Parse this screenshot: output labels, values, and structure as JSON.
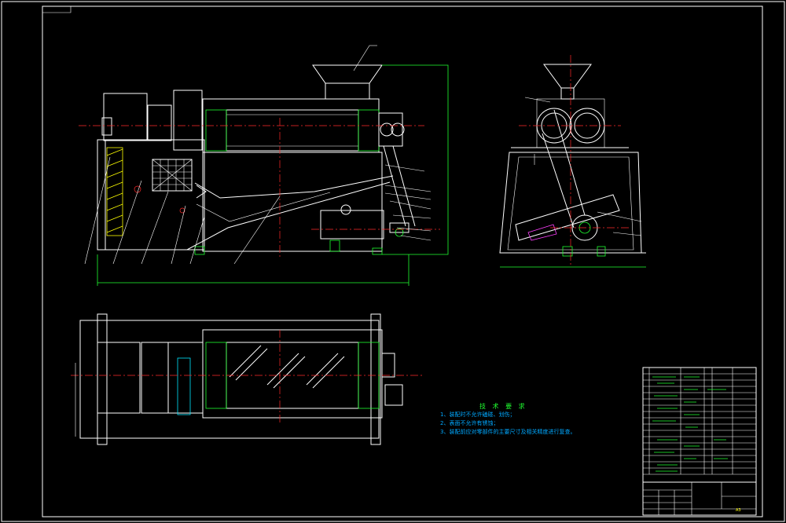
{
  "tech_requirements": {
    "title": "技 术 要 求",
    "items": [
      "1、装配时不允许磕碰、划伤；",
      "2、表面不允许有锈蚀；",
      "3、装配前应对零部件的主要尺寸及相关精度进行复查。"
    ]
  },
  "title_block": {
    "sheet_size": "A3"
  },
  "colors": {
    "background": "#000000",
    "outline": "#ffffff",
    "hatch": "#ffff00",
    "dimension": "#20ff30",
    "centerline": "#ff2a2a",
    "text": "#00a8ff"
  }
}
